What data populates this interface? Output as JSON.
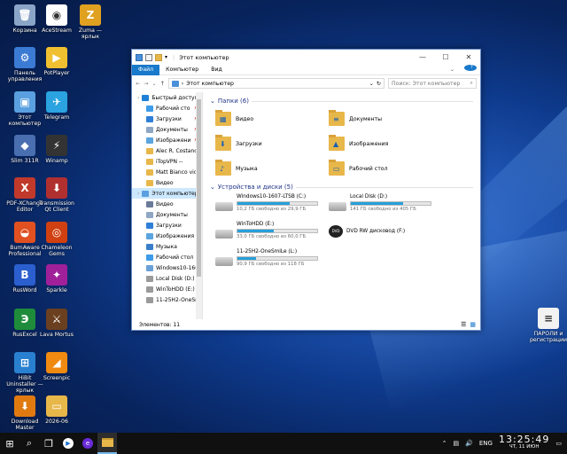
{
  "desktop": {
    "icons": [
      {
        "label": "Корзина",
        "glyph": "🗑",
        "color": "#8aa5c8"
      },
      {
        "label": "AceStream",
        "glyph": "◉",
        "color": "#ffffff"
      },
      {
        "label": "Zuma — ярлык",
        "glyph": "Z",
        "color": "#e0a020"
      },
      {
        "label": "Панель управления",
        "glyph": "⚙",
        "color": "#3b7bd4"
      },
      {
        "label": "PotPlayer",
        "glyph": "▶",
        "color": "#f0c030"
      },
      {
        "label": "Этот компьютер",
        "glyph": "▣",
        "color": "#5aa0e0"
      },
      {
        "label": "Telegram",
        "glyph": "✈",
        "color": "#2aa3e0"
      },
      {
        "label": "Slim 311R",
        "glyph": "◆",
        "color": "#4a6fb0"
      },
      {
        "label": "Winamp",
        "glyph": "⚡",
        "color": "#333333"
      },
      {
        "label": "PDF-XChange Editor",
        "glyph": "X",
        "color": "#c0392b"
      },
      {
        "label": "Transmission Qt Client",
        "glyph": "⬇",
        "color": "#b03030"
      },
      {
        "label": "BurnAware Professional",
        "glyph": "◒",
        "color": "#e05020"
      },
      {
        "label": "Chameleon Gems",
        "glyph": "◎",
        "color": "#d04010"
      },
      {
        "label": "RusWord",
        "glyph": "В",
        "color": "#2b5fcf"
      },
      {
        "label": "Sparkle",
        "glyph": "✦",
        "color": "#a0209a"
      },
      {
        "label": "RusExcel",
        "glyph": "Э",
        "color": "#1e8c3a"
      },
      {
        "label": "Lava Mortus",
        "glyph": "⚔",
        "color": "#6a4020"
      },
      {
        "label": "HiBit Uninstaller — ярлык",
        "glyph": "⊞",
        "color": "#2a80d0"
      },
      {
        "label": "Screenpic",
        "glyph": "◢",
        "color": "#f08a10"
      },
      {
        "label": "Download Master",
        "glyph": "⬇",
        "color": "#e07a10"
      },
      {
        "label": "2026-06",
        "glyph": "▭",
        "color": "#e8b74a"
      },
      {
        "label": "ПАРОЛИ и регистрации",
        "glyph": "≡",
        "color": "#f2f2f2"
      }
    ]
  },
  "window": {
    "title": "Этот компьютер",
    "ribbon_tabs": [
      "Файл",
      "Компьютер",
      "Вид"
    ],
    "address": "Этот компьютер",
    "search_placeholder": "Поиск: Этот компьютер",
    "nav_items": [
      {
        "label": "Быстрый доступ",
        "top": true,
        "pinned": false,
        "color": "#1e7fd6"
      },
      {
        "label": "Рабочий сто",
        "top": false,
        "pinned": true,
        "color": "#3d9be9"
      },
      {
        "label": "Загрузки",
        "top": false,
        "pinned": true,
        "color": "#2f7fd9"
      },
      {
        "label": "Документы",
        "top": false,
        "pinned": true,
        "color": "#8fa6c4"
      },
      {
        "label": "Изображени",
        "top": false,
        "pinned": true,
        "color": "#5aa5e0"
      },
      {
        "label": "Alec R. Costandi",
        "top": false,
        "pinned": false,
        "color": "#e8b74a"
      },
      {
        "label": "iTopVPN --",
        "top": false,
        "pinned": false,
        "color": "#e8b74a"
      },
      {
        "label": "Matt Bianco vide",
        "top": false,
        "pinned": false,
        "color": "#e8b74a"
      },
      {
        "label": "Видео",
        "top": false,
        "pinned": false,
        "color": "#e8b74a"
      },
      {
        "label": "Этот компьютер",
        "top": true,
        "pinned": false,
        "color": "#5aa0e0",
        "selected": true
      },
      {
        "label": "Видео",
        "top": false,
        "pinned": false,
        "color": "#6b7a99"
      },
      {
        "label": "Документы",
        "top": false,
        "pinned": false,
        "color": "#8fa6c4"
      },
      {
        "label": "Загрузки",
        "top": false,
        "pinned": false,
        "color": "#2f7fd9"
      },
      {
        "label": "Изображения",
        "top": false,
        "pinned": false,
        "color": "#5aa5e0"
      },
      {
        "label": "Музыка",
        "top": false,
        "pinned": false,
        "color": "#3a7ec9"
      },
      {
        "label": "Рабочий стол",
        "top": false,
        "pinned": false,
        "color": "#3d9be9"
      },
      {
        "label": "Windows10-1607",
        "top": false,
        "pinned": false,
        "color": "#6aa0d8"
      },
      {
        "label": "Local Disk (D:)",
        "top": false,
        "pinned": false,
        "color": "#9a9a9a"
      },
      {
        "label": "WinToHDD (E:)",
        "top": false,
        "pinned": false,
        "color": "#9a9a9a"
      },
      {
        "label": "11-25H2-OneSm",
        "top": false,
        "pinned": false,
        "color": "#9a9a9a"
      }
    ],
    "folders_header": "Папки (6)",
    "folders": [
      {
        "label": "Видео",
        "glyph": "▦"
      },
      {
        "label": "Документы",
        "glyph": "≡"
      },
      {
        "label": "Загрузки",
        "glyph": "⬇"
      },
      {
        "label": "Изображения",
        "glyph": "▲"
      },
      {
        "label": "Музыка",
        "glyph": "♪"
      },
      {
        "label": "Рабочий стол",
        "glyph": "▭"
      }
    ],
    "drives_header": "Устройства и диски (5)",
    "drives": [
      {
        "label": "Windows10-1607-LTSB (C:)",
        "free": "10,2 ГБ свободно из 29,9 ГБ",
        "used": 0.66,
        "dvd": false
      },
      {
        "label": "Local Disk (D:)",
        "free": "141 ГБ свободно из 405 ГБ",
        "used": 0.65,
        "dvd": false
      },
      {
        "label": "WinToHDD (E:)",
        "free": "33,0 ГБ свободно из 60,0 ГБ",
        "used": 0.45,
        "dvd": false
      },
      {
        "label": "DVD RW дисковод (F:)",
        "free": "",
        "used": null,
        "dvd": true
      },
      {
        "label": "11-25H2-OneSmiLe (L:)",
        "free": "90,9 ГБ свободно из 118 ГБ",
        "used": 0.23,
        "dvd": false
      }
    ],
    "status": "Элементов: 11"
  },
  "taskbar": {
    "lang": "ENG",
    "time": "13:25:49",
    "date": "ЧТ, 11 ИЮН"
  }
}
